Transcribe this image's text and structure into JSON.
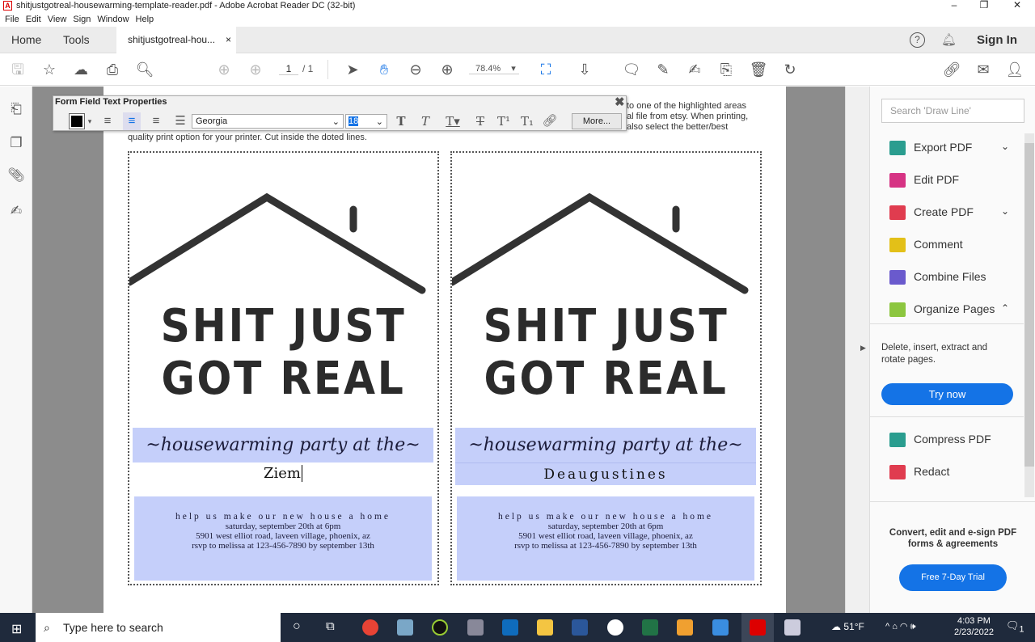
{
  "window": {
    "title": "shitjustgotreal-housewarming-template-reader.pdf - Adobe Acrobat Reader DC (32-bit)",
    "controls": [
      "minimize",
      "maximize",
      "close"
    ]
  },
  "menu": [
    "File",
    "Edit",
    "View",
    "Sign",
    "Window",
    "Help"
  ],
  "tabs": {
    "home": "Home",
    "tools": "Tools",
    "document": "shitjustgotreal-hou...",
    "close": "×",
    "sign_in": "Sign In"
  },
  "toolbar": {
    "page_current": "1",
    "page_total": "/ 1",
    "zoom": "78.4%"
  },
  "form_field_props": {
    "title": "Form Field Text Properties",
    "font": "Georgia",
    "size": "18",
    "more": "More..."
  },
  "document": {
    "instructions": [
      "to one of the highlighted areas",
      "al file from etsy.  When printing,",
      "also select the better/best",
      "quality print option for your printer. Cut inside the doted lines."
    ],
    "headline1": "SHIT JUST",
    "headline2": "GOT REAL",
    "script_line": "~housewarming party at the~",
    "cards": [
      {
        "name": "Ziem"
      },
      {
        "name": "Deaugustines"
      }
    ],
    "details": [
      "help us make our new house a home",
      "saturday, september 20th at 6pm",
      "5901 west elliot road, laveen village, phoenix, az",
      "rsvp to melissa at 123-456-7890 by september 13th"
    ]
  },
  "right_panel": {
    "search_placeholder": "Search 'Draw Line'",
    "tools": [
      {
        "label": "Export PDF",
        "color": "#2a9d8f",
        "chevron": "⌄"
      },
      {
        "label": "Edit PDF",
        "color": "#d63384",
        "chevron": ""
      },
      {
        "label": "Create PDF",
        "color": "#e03c4f",
        "chevron": "⌄"
      },
      {
        "label": "Comment",
        "color": "#e3c018",
        "chevron": ""
      },
      {
        "label": "Combine Files",
        "color": "#6a5acd",
        "chevron": ""
      },
      {
        "label": "Organize Pages",
        "color": "#8cc63f",
        "chevron": "⌃"
      }
    ],
    "organize_desc": "Delete, insert, extract and rotate pages.",
    "try_now": "Try now",
    "tools2": [
      {
        "label": "Compress PDF",
        "color": "#2a9d8f"
      },
      {
        "label": "Redact",
        "color": "#e03c4f"
      }
    ],
    "promo": "Convert, edit and e-sign PDF forms & agreements",
    "trial": "Free 7-Day Trial",
    "accent": "#1473e6"
  },
  "taskbar": {
    "search": "Type here to search",
    "weather": "51°F",
    "time": "4:03 PM",
    "date": "2/23/2022",
    "notifications": "1"
  }
}
